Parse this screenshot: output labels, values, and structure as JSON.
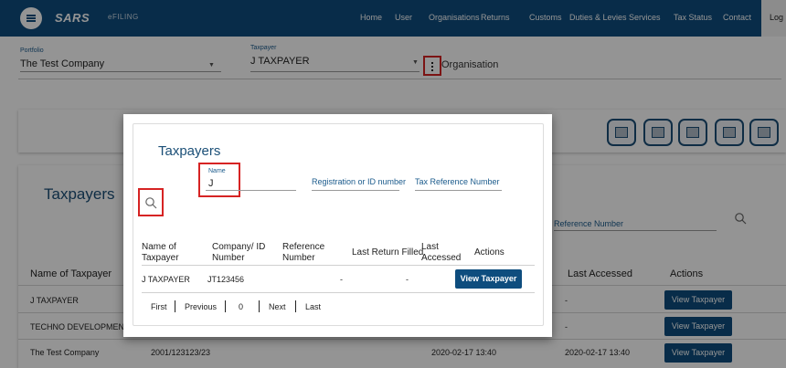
{
  "header": {
    "logo_text": "SARS",
    "logo_sub": "eFILING",
    "nav": [
      "Home",
      "User",
      "Organisations",
      "Returns",
      "Customs",
      "Duties & Levies",
      "Services",
      "Tax Status",
      "Contact"
    ],
    "login_label": "Log",
    "brand_color": "#0e4d7e"
  },
  "selectors": {
    "portfolio_label": "Portfolio",
    "portfolio_value": "The Test Company",
    "taxpayer_label": "Taxpayer",
    "taxpayer_value": "J TAXPAYER",
    "organisation_label": "Organisation"
  },
  "background_page": {
    "title": "Taxpayers",
    "search_placeholder": "Reference Number",
    "columns": [
      "Name of Taxpayer",
      "Last Accessed",
      "Actions"
    ],
    "rows": [
      {
        "name": "J TAXPAYER",
        "number": "",
        "last_return": "",
        "last_accessed": "-",
        "action": "View Taxpayer"
      },
      {
        "name": "TECHNO DEVELOPMENTS C",
        "number": "",
        "last_return": "",
        "last_accessed": "-",
        "action": "View Taxpayer"
      },
      {
        "name": "The Test Company",
        "number": "2001/123123/23",
        "last_return": "2020-02-17 13:40",
        "last_accessed": "2020-02-17 13:40",
        "action": "View Taxpayer"
      }
    ]
  },
  "modal": {
    "title": "Taxpayers",
    "name_label": "Name",
    "name_value": "J",
    "registration_placeholder": "Registration or ID number",
    "tax_ref_placeholder": "Tax Reference Number",
    "columns": {
      "name_l1": "Name of",
      "name_l2": "Taxpayer",
      "company_l1": "Company/ ID",
      "company_l2": "Number",
      "ref_l1": "Reference",
      "ref_l2": "Number",
      "last_return": "Last Return Filled",
      "last_accessed_l1": "Last",
      "last_accessed_l2": "Accessed",
      "actions": "Actions"
    },
    "rows": [
      {
        "name": "J TAXPAYER",
        "company_id": "JT123456",
        "reference": "-",
        "last_return": "-",
        "action": "View Taxpayer"
      }
    ],
    "pagination": {
      "first": "First",
      "previous": "Previous",
      "page": "0",
      "next": "Next",
      "last": "Last"
    }
  },
  "highlight_color": "#d62323"
}
